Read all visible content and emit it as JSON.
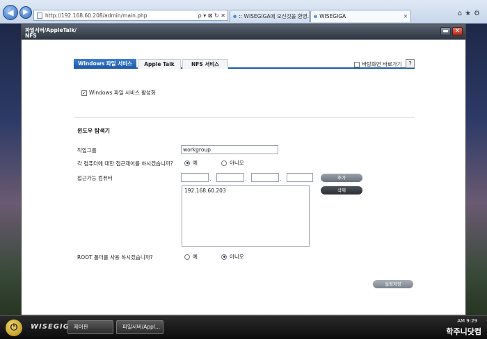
{
  "browser": {
    "url": "http://192.168.60.208/admin/main.php",
    "address_controls": "ρ ▾ ⊠ ↻ ✕",
    "tabs": [
      {
        "label": ":: WISEGIGA에 오신것을 환영..."
      },
      {
        "label": "WISEGIGA"
      }
    ]
  },
  "window": {
    "title_line1": "파일서버/AppleTalk/",
    "title_line2": "NFS"
  },
  "service_tabs": [
    "Windows 파일 서비스",
    "Apple Talk",
    "NFS 서비스"
  ],
  "shortcut_label": "바탕화면 바로가기",
  "help_label": "?",
  "enable_label": "Windows 파일 서비스 활성화",
  "section_title": "윈도우 탐색기",
  "workgroup": {
    "label": "작업그룹",
    "value": "workgroup"
  },
  "access_control": {
    "label": "각 컴퓨터에 대한 접근제어를 하시겠습니까?",
    "yes": "예",
    "no": "아니오",
    "selected": "yes"
  },
  "allowed_computers": {
    "label": "접근가능 컴퓨터",
    "list": [
      "192.168.60.203"
    ],
    "add_label": "추가",
    "delete_label": "삭제"
  },
  "root_folder": {
    "label": "ROOT 폴더를 사용 하시겠습니까?",
    "yes": "예",
    "no": "아니오",
    "selected": "no"
  },
  "save_label": "설정저장",
  "taskbar": {
    "logo": "WISEGIGA",
    "buttons": [
      "제어판",
      "파일서버/Appl..."
    ],
    "clock": "AM 9:29",
    "watermark": "학주니닷컴"
  }
}
